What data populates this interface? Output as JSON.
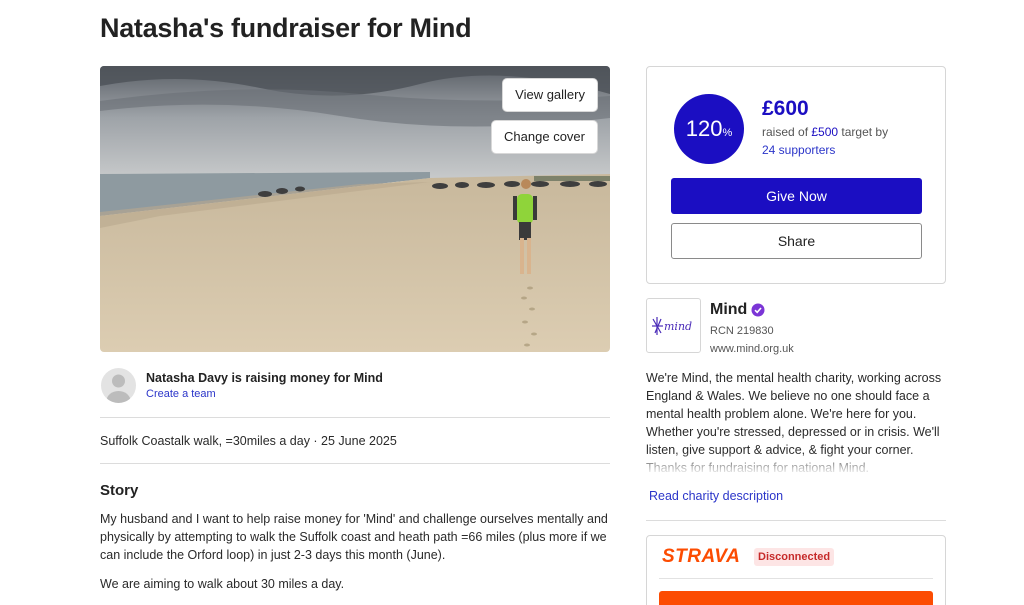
{
  "page": {
    "title": "Natasha's fundraiser for Mind"
  },
  "cover": {
    "view_gallery": "View gallery",
    "change_cover": "Change cover"
  },
  "organiser": {
    "text": "Natasha Davy is raising money for Mind",
    "create_team": "Create a team"
  },
  "event": {
    "line": "Suffolk Coastalk walk, =30miles a day · 25 June 2025"
  },
  "story": {
    "heading": "Story",
    "p1": "My husband and I want to help raise money for 'Mind' and challenge ourselves mentally and physically by attempting to walk the Suffolk coast and heath path =66 miles (plus more if we can include the Orford loop) in just 2-3 days this month (June).",
    "p2": "We are aiming to walk about 30 miles a day."
  },
  "donation": {
    "percent": "120",
    "percent_sign": "%",
    "progress_fraction": 1.2,
    "raised": "£600",
    "raised_of": "raised of ",
    "target": "£500",
    "target_suffix": " target by",
    "supporters": "24 supporters",
    "give_now": "Give Now",
    "share": "Share"
  },
  "charity": {
    "name": "Mind",
    "logo_text": "mind",
    "rcn": "RCN 219830",
    "url": "www.mind.org.uk",
    "description": "We're Mind, the mental health charity, working across England & Wales. We believe no one should face a mental health problem alone. We're here for you. Whether you're stressed, depressed or in crisis. We'll listen, give support & advice, & fight your corner. Thanks for fundraising for national Mind.",
    "read_more": "Read charity description"
  },
  "strava": {
    "logo": "STRAVA",
    "status": "Disconnected"
  },
  "colors": {
    "brand_blue": "#1b0ec2",
    "link_blue": "#2b35c9",
    "strava_orange": "#fc4c02",
    "verified_purple": "#7b35d6"
  }
}
